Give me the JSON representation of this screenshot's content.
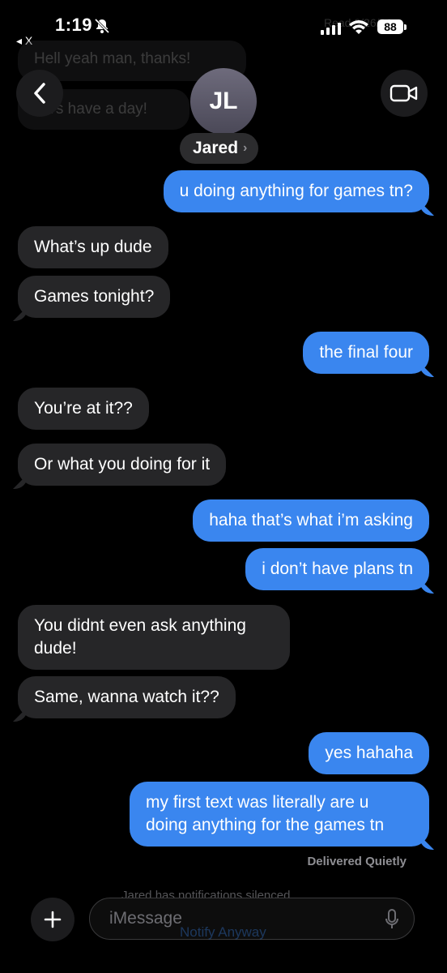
{
  "status": {
    "time": "1:19",
    "back_app": "◂ X",
    "battery": "88"
  },
  "ghost": {
    "read": "Read 3/26/26",
    "msg1": "Hell yeah man, thanks!",
    "msg2": "t's have a day!"
  },
  "header": {
    "initials": "JL",
    "name": "Jared",
    "chevron": "›"
  },
  "messages": [
    {
      "side": "out",
      "text": "u doing anything for games tn?"
    },
    {
      "side": "in",
      "text": "What’s up dude"
    },
    {
      "side": "in",
      "text": "Games tonight?"
    },
    {
      "side": "out",
      "text": "the final four"
    },
    {
      "side": "in",
      "text": "You’re at it??"
    },
    {
      "side": "in",
      "text": "Or what you doing for it"
    },
    {
      "side": "out",
      "text": "haha that’s what i’m asking"
    },
    {
      "side": "out",
      "text": "i don’t have plans tn"
    },
    {
      "side": "in",
      "text": "You didnt even ask anything dude!"
    },
    {
      "side": "in",
      "text": "Same, wanna watch it??"
    },
    {
      "side": "out",
      "text": "yes hahaha"
    },
    {
      "side": "out",
      "text": "my first text was literally are u doing anything for the games tn"
    }
  ],
  "delivered": "Delivered Quietly",
  "silenced": "Jared has notifications silenced",
  "notify": "Notify Anyway",
  "compose": {
    "placeholder": "iMessage"
  },
  "icons": {
    "back": "chevron-left-icon",
    "video": "video-camera-icon",
    "plus": "plus-icon",
    "mic": "microphone-icon",
    "bell": "bell-slash-icon"
  },
  "colors": {
    "outgoing": "#3a86ef",
    "incoming": "#262628",
    "background": "#000000"
  }
}
